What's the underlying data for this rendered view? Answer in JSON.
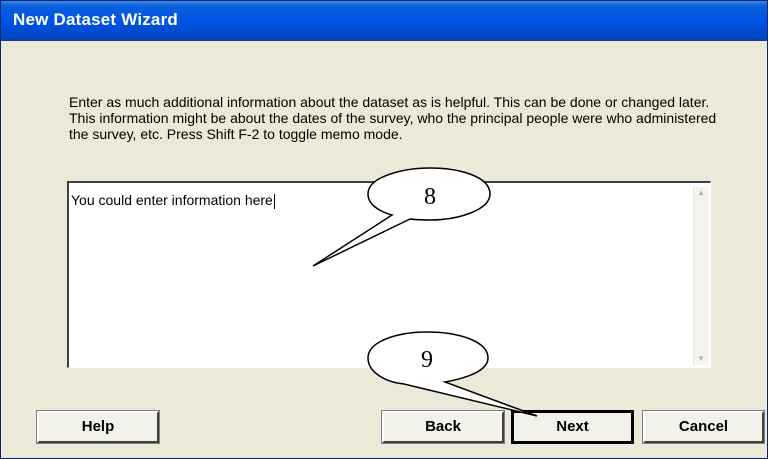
{
  "window": {
    "title": "New Dataset Wizard"
  },
  "instructions": "Enter as much additional information about the dataset as is helpful.  This can be done or changed later.  This information might be about the dates of the survey, who the principal people were who administered the survey, etc.  Press Shift F-2 to toggle memo mode.",
  "memo": {
    "value": "You could enter information here"
  },
  "buttons": {
    "help": "Help",
    "back": "Back",
    "next": "Next",
    "cancel": "Cancel"
  },
  "callouts": {
    "memo_number": "8",
    "next_number": "9"
  },
  "icons": {
    "scroll_up": "scroll-up-arrow-icon",
    "scroll_down": "scroll-down-arrow-icon"
  }
}
